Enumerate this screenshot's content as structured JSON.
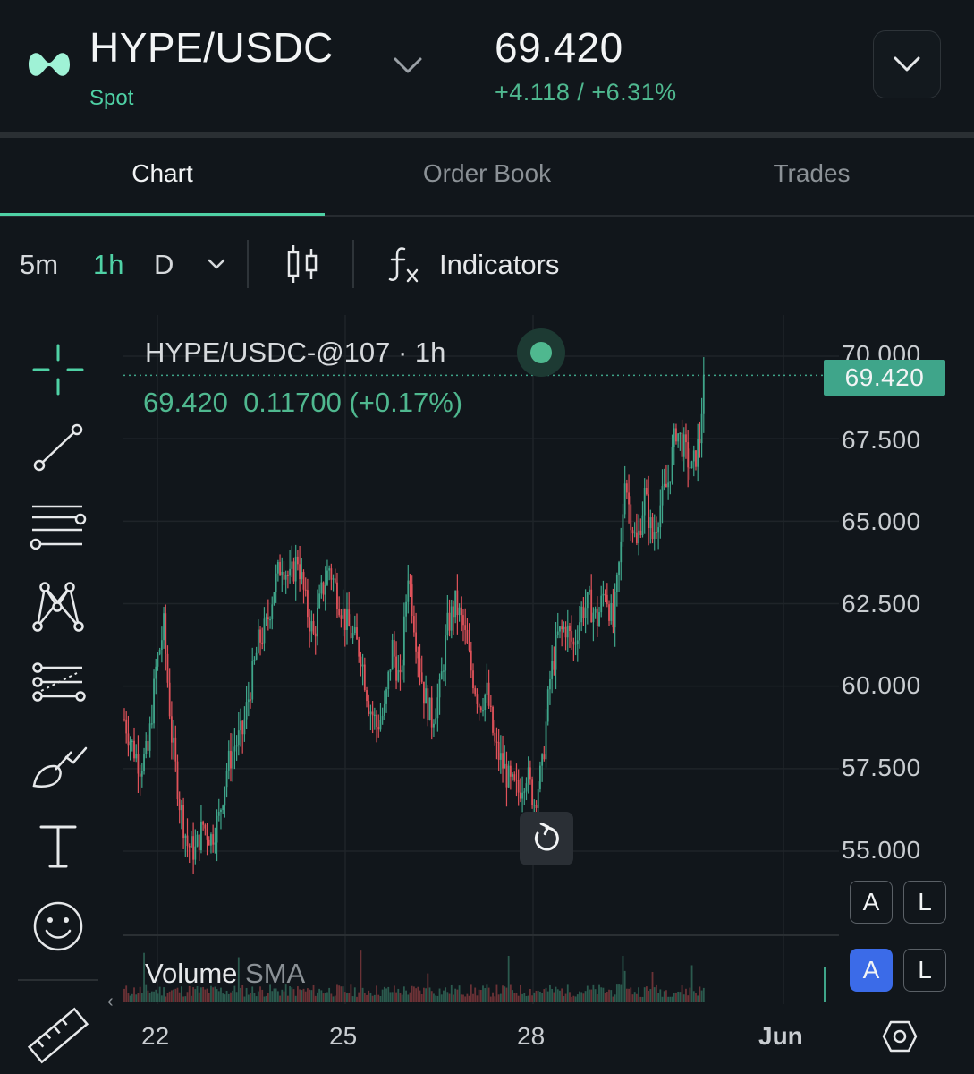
{
  "header": {
    "pair": "HYPE/USDC",
    "market_type": "Spot",
    "price": "69.420",
    "change": "+4.118 / +6.31%",
    "accent_color": "#4fd1a5"
  },
  "tabs": [
    {
      "label": "Chart",
      "active": true
    },
    {
      "label": "Order Book",
      "active": false
    },
    {
      "label": "Trades",
      "active": false
    }
  ],
  "toolbar": {
    "timeframes": [
      "5m",
      "1h",
      "D"
    ],
    "selected_timeframe": "1h",
    "indicators_label": "Indicators"
  },
  "drawing_tools": [
    "crosshair-icon",
    "trend-line-icon",
    "horizontal-lines-icon",
    "pattern-icon",
    "forecast-icon",
    "brush-icon",
    "text-icon",
    "emoji-icon",
    "ruler-icon"
  ],
  "chart": {
    "title": "HYPE/USDC-@107 · 1h",
    "legend_close": "69.420",
    "legend_change": "0.11700 (+0.17%)",
    "current_price_tag": "69.420",
    "volume_label": "Volume",
    "volume_sma_label": "SMA",
    "auto_label": "A",
    "log_label": "L"
  },
  "chart_data": {
    "type": "candlestick",
    "y_ticks": [
      "70.000",
      "67.500",
      "65.000",
      "62.500",
      "60.000",
      "57.500",
      "55.000"
    ],
    "x_ticks": [
      "22",
      "25",
      "28",
      "Jun"
    ],
    "ylim": [
      53.5,
      70.5
    ],
    "last_price": 69.42,
    "path_anchors": [
      [
        0,
        59.0
      ],
      [
        4,
        58.2
      ],
      [
        8,
        57.6
      ],
      [
        12,
        58.0
      ],
      [
        16,
        60.5
      ],
      [
        20,
        61.8
      ],
      [
        24,
        58.5
      ],
      [
        28,
        56.5
      ],
      [
        32,
        55.2
      ],
      [
        36,
        55.0
      ],
      [
        40,
        55.8
      ],
      [
        44,
        55.4
      ],
      [
        48,
        56.0
      ],
      [
        52,
        57.5
      ],
      [
        56,
        58.2
      ],
      [
        60,
        58.6
      ],
      [
        64,
        60.0
      ],
      [
        68,
        61.3
      ],
      [
        72,
        61.8
      ],
      [
        76,
        63.0
      ],
      [
        80,
        63.8
      ],
      [
        84,
        63.2
      ],
      [
        88,
        63.9
      ],
      [
        92,
        62.5
      ],
      [
        96,
        61.5
      ],
      [
        100,
        62.8
      ],
      [
        104,
        63.6
      ],
      [
        108,
        62.8
      ],
      [
        112,
        62.0
      ],
      [
        116,
        61.5
      ],
      [
        120,
        61.0
      ],
      [
        124,
        59.5
      ],
      [
        128,
        58.8
      ],
      [
        132,
        59.2
      ],
      [
        136,
        61.2
      ],
      [
        140,
        60.0
      ],
      [
        144,
        63.5
      ],
      [
        148,
        61.5
      ],
      [
        152,
        59.8
      ],
      [
        156,
        59.0
      ],
      [
        160,
        59.8
      ],
      [
        164,
        61.8
      ],
      [
        168,
        62.5
      ],
      [
        172,
        61.8
      ],
      [
        176,
        60.5
      ],
      [
        180,
        59.5
      ],
      [
        184,
        59.8
      ],
      [
        188,
        58.2
      ],
      [
        192,
        57.6
      ],
      [
        196,
        57.0
      ],
      [
        200,
        56.8
      ],
      [
        204,
        57.4
      ],
      [
        208,
        56.5
      ],
      [
        212,
        57.5
      ],
      [
        216,
        60.2
      ],
      [
        220,
        61.5
      ],
      [
        224,
        61.8
      ],
      [
        228,
        61.2
      ],
      [
        232,
        62.3
      ],
      [
        236,
        62.5
      ],
      [
        240,
        62.0
      ],
      [
        244,
        63.0
      ],
      [
        248,
        61.8
      ],
      [
        252,
        64.2
      ],
      [
        254,
        66.5
      ],
      [
        256,
        65.5
      ],
      [
        260,
        64.2
      ],
      [
        264,
        65.8
      ],
      [
        268,
        64.5
      ],
      [
        272,
        65.5
      ],
      [
        276,
        66.2
      ],
      [
        280,
        67.8
      ],
      [
        284,
        67.2
      ],
      [
        288,
        66.5
      ],
      [
        292,
        67.5
      ],
      [
        294,
        69.42
      ]
    ],
    "volume_spike_positions": [
      10,
      58,
      120,
      154,
      195,
      253,
      254,
      268,
      288
    ]
  },
  "bottom": {
    "scroll_left_glyph": "‹"
  }
}
